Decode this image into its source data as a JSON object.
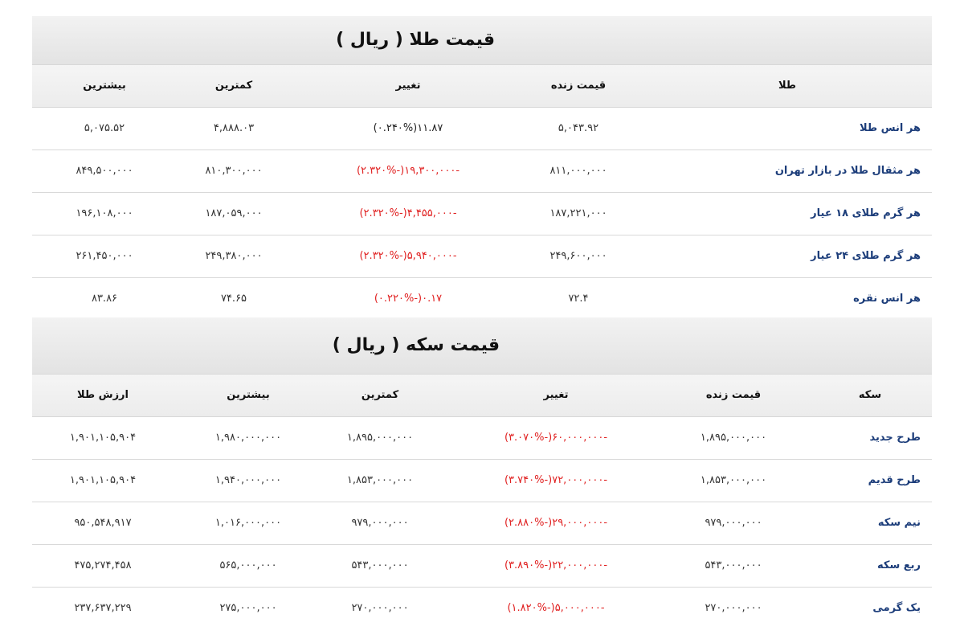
{
  "gold": {
    "title": "قیمت طلا ( ریال )",
    "headers": {
      "name": "طلا",
      "price": "قیمت زنده",
      "change": "تغییر",
      "low": "کمترین",
      "high": "بیشترین"
    },
    "rows": [
      {
        "name": "هر انس طلا",
        "price": "۵,۰۴۳.۹۲",
        "change": "۱۱.۸۷(۰.۲۴۰%)",
        "change_dir": "up",
        "low": "۴,۸۸۸.۰۳",
        "high": "۵,۰۷۵.۵۲"
      },
      {
        "name": "هر مثقال طلا در بازار تهران",
        "price": "۸۱۱,۰۰۰,۰۰۰",
        "change": "-۱۹,۳۰۰,۰۰۰(-۲.۳۲۰%)",
        "change_dir": "down",
        "low": "۸۱۰,۳۰۰,۰۰۰",
        "high": "۸۴۹,۵۰۰,۰۰۰"
      },
      {
        "name": "هر گرم طلای ۱۸ عیار",
        "price": "۱۸۷,۲۲۱,۰۰۰",
        "change": "-۴,۴۵۵,۰۰۰(-۲.۳۲۰%)",
        "change_dir": "down",
        "low": "۱۸۷,۰۵۹,۰۰۰",
        "high": "۱۹۶,۱۰۸,۰۰۰"
      },
      {
        "name": "هر گرم طلای ۲۴ عیار",
        "price": "۲۴۹,۶۰۰,۰۰۰",
        "change": "-۵,۹۴۰,۰۰۰(-۲.۳۲۰%)",
        "change_dir": "down",
        "low": "۲۴۹,۳۸۰,۰۰۰",
        "high": "۲۶۱,۴۵۰,۰۰۰"
      },
      {
        "name": "هر انس نقره",
        "price": "۷۲.۴",
        "change": "۰.۱۷(-۰.۲۲۰%)",
        "change_dir": "down",
        "low": "۷۴.۶۵",
        "high": "۸۳.۸۶"
      }
    ]
  },
  "coin": {
    "title": "قیمت سکه ( ریال )",
    "headers": {
      "name": "سکه",
      "price": "قیمت زنده",
      "change": "تغییر",
      "low": "کمترین",
      "high": "بیشترین",
      "value": "ارزش طلا"
    },
    "rows": [
      {
        "name": "طرح جدید",
        "price": "۱,۸۹۵,۰۰۰,۰۰۰",
        "change": "-۶۰,۰۰۰,۰۰۰(-۳.۰۷۰%)",
        "change_dir": "down",
        "low": "۱,۸۹۵,۰۰۰,۰۰۰",
        "high": "۱,۹۸۰,۰۰۰,۰۰۰",
        "value": "۱,۹۰۱,۱۰۵,۹۰۴"
      },
      {
        "name": "طرح قدیم",
        "price": "۱,۸۵۳,۰۰۰,۰۰۰",
        "change": "-۷۲,۰۰۰,۰۰۰(-۳.۷۴۰%)",
        "change_dir": "down",
        "low": "۱,۸۵۳,۰۰۰,۰۰۰",
        "high": "۱,۹۴۰,۰۰۰,۰۰۰",
        "value": "۱,۹۰۱,۱۰۵,۹۰۴"
      },
      {
        "name": "نیم سکه",
        "price": "۹۷۹,۰۰۰,۰۰۰",
        "change": "-۲۹,۰۰۰,۰۰۰(-۲.۸۸۰%)",
        "change_dir": "down",
        "low": "۹۷۹,۰۰۰,۰۰۰",
        "high": "۱,۰۱۶,۰۰۰,۰۰۰",
        "value": "۹۵۰,۵۴۸,۹۱۷"
      },
      {
        "name": "ربع سکه",
        "price": "۵۴۳,۰۰۰,۰۰۰",
        "change": "-۲۲,۰۰۰,۰۰۰(-۳.۸۹۰%)",
        "change_dir": "down",
        "low": "۵۴۳,۰۰۰,۰۰۰",
        "high": "۵۶۵,۰۰۰,۰۰۰",
        "value": "۴۷۵,۲۷۴,۴۵۸"
      },
      {
        "name": "یک گرمی",
        "price": "۲۷۰,۰۰۰,۰۰۰",
        "change": "-۵,۰۰۰,۰۰۰(-۱.۸۲۰%)",
        "change_dir": "down",
        "low": "۲۷۰,۰۰۰,۰۰۰",
        "high": "۲۷۵,۰۰۰,۰۰۰",
        "value": "۲۳۷,۶۳۷,۲۲۹"
      }
    ]
  }
}
